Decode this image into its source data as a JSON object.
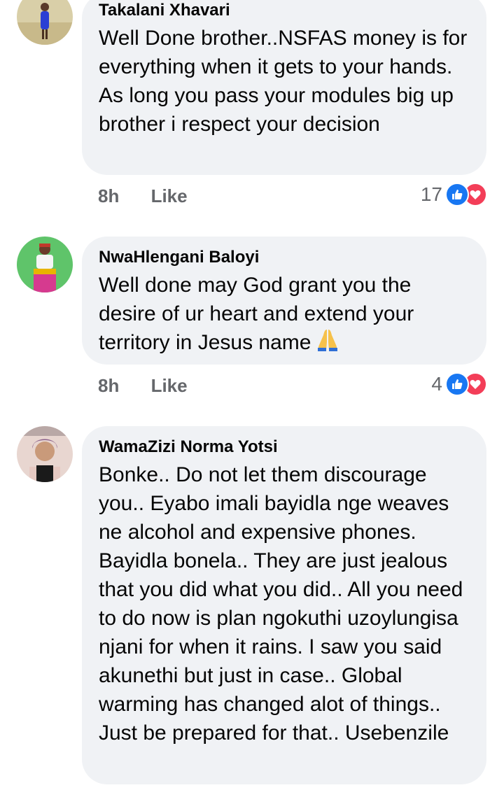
{
  "comments": [
    {
      "author": "Takalani Xhavari",
      "text": "Well Done brother..NSFAS  money is for everything when it gets to your hands. As long you pass your modules big up brother i respect your decision",
      "time": "8h",
      "like_label": "Like",
      "reaction_count": "17",
      "reaction_icons": [
        "like-icon",
        "love-icon"
      ]
    },
    {
      "author": "NwaHlengani Baloyi",
      "text": "Well done may God grant you the desire of ur heart and extend your territory in Jesus name",
      "emoji": "🙏",
      "time": "8h",
      "like_label": "Like",
      "reaction_count": "4",
      "reaction_icons": [
        "like-icon",
        "love-icon"
      ]
    },
    {
      "author": "WamaZizi Norma Yotsi",
      "text": "Bonke.. Do not let them discourage you.. Eyabo imali bayidla nge weaves ne alcohol and expensive phones. Bayidla bonela.. They are just jealous that you did what you did.. All you need to do now is plan ngokuthi uzoylungisa njani for when it rains. I saw you said akunethi but just in case.. Global warming has changed alot of things.. Just be prepared for that..  Usebenzile"
    }
  ],
  "colors": {
    "bubble": "#f0f2f5",
    "meta_text": "#65676b",
    "like_blue": "#1877f2",
    "love_red": "#f33e58"
  }
}
